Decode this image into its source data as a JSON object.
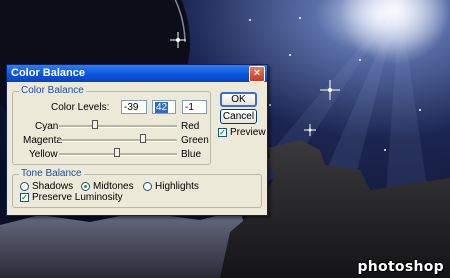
{
  "dialog": {
    "title": "Color Balance",
    "close_glyph": "×",
    "color_balance_group": "Color Balance",
    "color_levels_label": "Color Levels:",
    "levels": [
      "-39",
      "42",
      "-1"
    ],
    "sliders": [
      {
        "left": "Cyan",
        "right": "Red",
        "value": -39
      },
      {
        "left": "Magenta",
        "right": "Green",
        "value": 42
      },
      {
        "left": "Yellow",
        "right": "Blue",
        "value": -1
      }
    ],
    "tone_balance_group": "Tone Balance",
    "tones": [
      "Shadows",
      "Midtones",
      "Highlights"
    ],
    "selected_tone": "Midtones",
    "preserve_luminosity": "Preserve Luminosity",
    "preserve_luminosity_checked": true,
    "ok_label": "OK",
    "cancel_label": "Cancel",
    "preview_label": "Preview",
    "preview_checked": true,
    "check_glyph": "✓"
  },
  "watermark": "photoshop",
  "colors": {
    "titlebar": "#0a53d6",
    "dialog_bg": "#ece9d8",
    "group_label": "#1a4ea8"
  }
}
